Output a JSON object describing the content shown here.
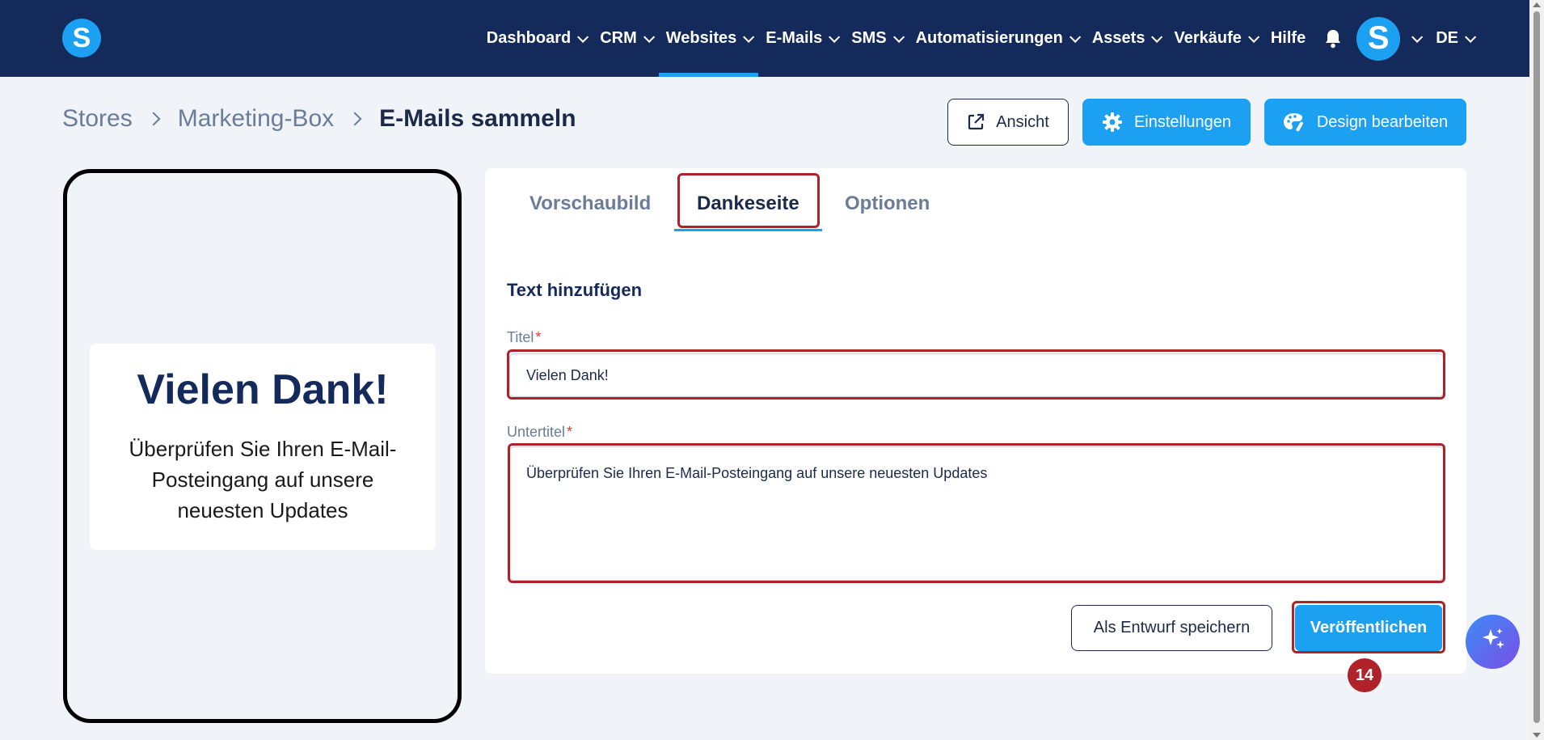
{
  "nav": {
    "logo_letter": "S",
    "items": [
      {
        "label": "Dashboard"
      },
      {
        "label": "CRM"
      },
      {
        "label": "Websites",
        "active": true
      },
      {
        "label": "E-Mails"
      },
      {
        "label": "SMS"
      },
      {
        "label": "Automatisierungen"
      },
      {
        "label": "Assets"
      },
      {
        "label": "Verkäufe"
      }
    ],
    "help_label": "Hilfe",
    "avatar_letter": "S",
    "language": "DE"
  },
  "breadcrumb": {
    "items": [
      "Stores",
      "Marketing-Box"
    ],
    "current": "E-Mails sammeln"
  },
  "header_buttons": {
    "view": "Ansicht",
    "settings": "Einstellungen",
    "design": "Design bearbeiten"
  },
  "preview": {
    "title": "Vielen Dank!",
    "subtitle": "Überprüfen Sie Ihren E-Mail-Posteingang auf unsere neuesten Updates"
  },
  "tabs": [
    {
      "label": "Vorschaubild"
    },
    {
      "label": "Dankeseite",
      "active": true
    },
    {
      "label": "Optionen"
    }
  ],
  "form": {
    "section_title": "Text hinzufügen",
    "title_label": "Titel",
    "title_value": "Vielen Dank!",
    "subtitle_label": "Untertitel",
    "subtitle_value": "Überprüfen Sie Ihren E-Mail-Posteingang auf unsere neuesten Updates",
    "required_mark": "*"
  },
  "actions": {
    "draft": "Als Entwurf speichern",
    "publish": "Veröffentlichen"
  },
  "step_badge": "14",
  "colors": {
    "nav_bg": "#142a5b",
    "accent": "#1ba0f2",
    "highlight": "#b0222a",
    "page_bg": "#f0f3f8"
  }
}
